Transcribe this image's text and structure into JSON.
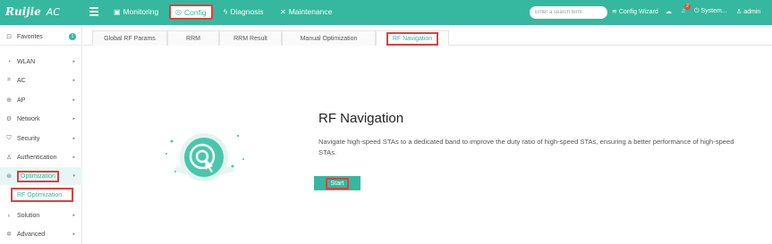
{
  "brand": {
    "logo": "Ruijie",
    "product": "AC"
  },
  "topnav": {
    "monitoring": "Monitoring",
    "config": "Config",
    "diagnosis": "Diagnosis",
    "maintenance": "Maintenance"
  },
  "search": {
    "placeholder": "Enter a search term"
  },
  "topright": {
    "wizard": "Config Wizard",
    "notification_count": "2",
    "system": "System...",
    "user": "admin"
  },
  "sidebar": {
    "favorites": "Favorites",
    "favorites_count": "1",
    "items": [
      {
        "label": "WLAN",
        "icon": "wifi-icon"
      },
      {
        "label": "AC",
        "icon": "ac-icon"
      },
      {
        "label": "AP",
        "icon": "ap-icon"
      },
      {
        "label": "Network",
        "icon": "network-icon"
      },
      {
        "label": "Security",
        "icon": "shield-icon"
      },
      {
        "label": "Authentication",
        "icon": "user-icon"
      },
      {
        "label": "Optimization",
        "icon": "optimization-icon"
      },
      {
        "label": "Solution",
        "icon": "bulb-icon"
      },
      {
        "label": "Advanced",
        "icon": "gear-icon"
      }
    ],
    "sub_item": "RF Optimization"
  },
  "tabs": [
    "Global RF Params",
    "RRM",
    "RRM Result",
    "Manual Optimization",
    "RF Navigation"
  ],
  "content": {
    "title": "RF Navigation",
    "description": "Navigate high-speed STAs to a dedicated band to improve the duty ratio of high-speed STAs, ensuring a better performance of high-speed STAs.",
    "start_button": "Start"
  },
  "colors": {
    "accent": "#35b89f",
    "highlight": "#e0403e"
  }
}
